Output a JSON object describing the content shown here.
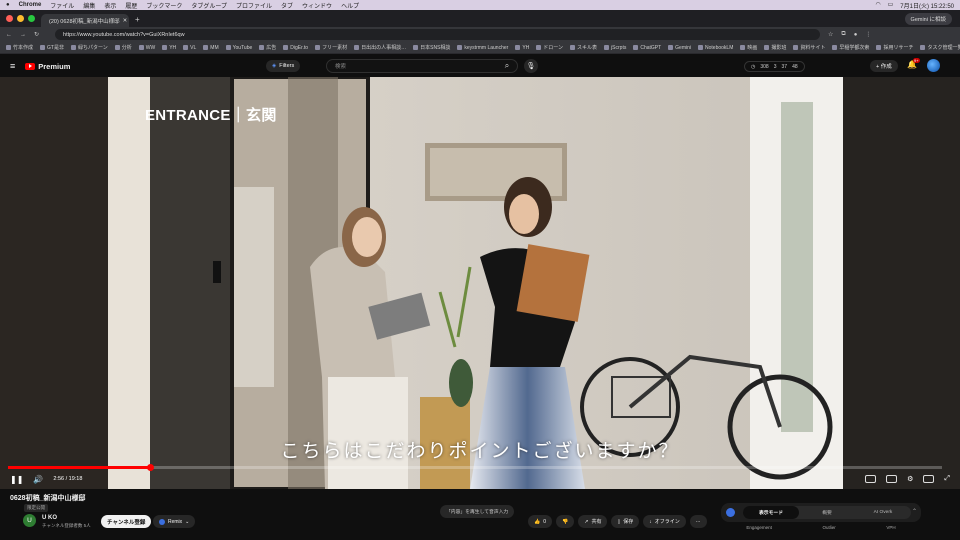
{
  "macos": {
    "app": "Chrome",
    "menus": [
      "ファイル",
      "編集",
      "表示",
      "履歴",
      "ブックマーク",
      "タブグループ",
      "プロファイル",
      "タブ",
      "ウィンドウ",
      "ヘルプ"
    ],
    "clock": "7月1日(火) 15:22:50"
  },
  "browser": {
    "tab_title": "(20) 0628初稿_新潟中山様邸",
    "url": "https://www.youtube.com/watch?v=GuiXRnIet6qw",
    "gemini_label": "Gemini に相談",
    "bookmarks": [
      "竹本作成",
      "GT是非",
      "緑ちパターン",
      "分析",
      "WW",
      "YH",
      "VL",
      "MM",
      "YouTube",
      "広告",
      "DigEr.to",
      "フリー素材",
      "日出出の人事相談…",
      "日本SNS相談",
      "keystrmm Launcher",
      "YH",
      "ドローン",
      "スキル表",
      "jScrpts",
      "ChatGPT",
      "Gemini",
      "NotebookLM",
      "映画",
      "撮影班",
      "資料サイト",
      "早稲学都次索",
      "採用リサーチ",
      "タスク管理一覧 - Go…"
    ]
  },
  "youtube": {
    "brand": "Premium",
    "filters_label": "Filters",
    "search_placeholder": "検索",
    "stats": [
      "308",
      "3",
      "37",
      "48"
    ],
    "create_label": "+ 作成",
    "notifications": "9+"
  },
  "video": {
    "overlay_title": "ENTRANCE｜玄関",
    "subtitle": "こちらはこだわりポイントございますか？",
    "time": "2:56 / 19:18",
    "progress": 0.152
  },
  "info": {
    "title": "0628初稿_新潟中山様邸",
    "visibility": "限定公開",
    "channel_initial": "U",
    "channel_name": "U KO",
    "subscribers": "チャンネル登録者数 5人",
    "subscribe_label": "チャンネル登録",
    "remix_label": "Remix",
    "hint": "「内容」を再生して音声入力",
    "actions": {
      "like": "0",
      "share": "共有",
      "save": "保存",
      "offline": "オフライン"
    },
    "panel_tabs": [
      "表示モード",
      "概要",
      "AI Overk"
    ],
    "panel_labels": [
      "Engagement",
      "Outlier",
      "VPH"
    ]
  },
  "colors": {
    "accent": "#ff0000",
    "page_bg": "#0f0f0f"
  }
}
